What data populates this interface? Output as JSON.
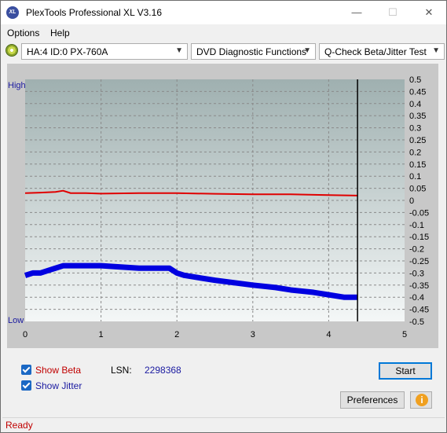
{
  "window": {
    "title": "PlexTools Professional XL V3.16",
    "app_icon_text": "XL",
    "minimize": "—",
    "maximize": "☐",
    "close": "✕"
  },
  "menu": {
    "options": "Options",
    "help": "Help"
  },
  "toolbar": {
    "drive": "HA:4 ID:0  PX-760A",
    "function": "DVD Diagnostic Functions",
    "test": "Q-Check Beta/Jitter Test"
  },
  "chart_data": {
    "type": "line",
    "left_axis": {
      "top_label": "High",
      "bottom_label": "Low"
    },
    "x": {
      "ticks": [
        0,
        1,
        2,
        3,
        4,
        5
      ],
      "lim": [
        0,
        5
      ]
    },
    "y_right": {
      "ticks": [
        0.5,
        0.45,
        0.4,
        0.35,
        0.3,
        0.25,
        0.2,
        0.15,
        0.1,
        0.05,
        0,
        -0.05,
        -0.1,
        -0.15,
        -0.2,
        -0.25,
        -0.3,
        -0.35,
        -0.4,
        -0.45,
        -0.5
      ],
      "lim": [
        -0.5,
        0.5
      ]
    },
    "end_marker_x": 4.38,
    "series": [
      {
        "color": "#e00000",
        "x": [
          0,
          0.2,
          0.4,
          0.5,
          0.6,
          0.8,
          1.0,
          1.5,
          2.0,
          2.5,
          3.0,
          3.5,
          4.0,
          4.38
        ],
        "y": [
          0.03,
          0.032,
          0.035,
          0.04,
          0.03,
          0.03,
          0.028,
          0.03,
          0.03,
          0.027,
          0.025,
          0.025,
          0.022,
          0.02
        ]
      },
      {
        "color": "#0000e0",
        "x": [
          0,
          0.1,
          0.2,
          0.3,
          0.4,
          0.5,
          0.6,
          0.8,
          1.0,
          1.5,
          1.9,
          2.0,
          2.1,
          2.5,
          3.0,
          3.3,
          3.5,
          3.8,
          4.0,
          4.2,
          4.38
        ],
        "y": [
          -0.31,
          -0.3,
          -0.3,
          -0.29,
          -0.28,
          -0.27,
          -0.27,
          -0.27,
          -0.27,
          -0.28,
          -0.28,
          -0.3,
          -0.31,
          -0.33,
          -0.35,
          -0.36,
          -0.37,
          -0.38,
          -0.39,
          -0.4,
          -0.4
        ]
      }
    ]
  },
  "bottom": {
    "show_beta": "Show Beta",
    "show_jitter": "Show Jitter",
    "lsn_label": "LSN:",
    "lsn_value": "2298368",
    "start": "Start",
    "preferences": "Preferences",
    "info_glyph": "i"
  },
  "status": "Ready"
}
